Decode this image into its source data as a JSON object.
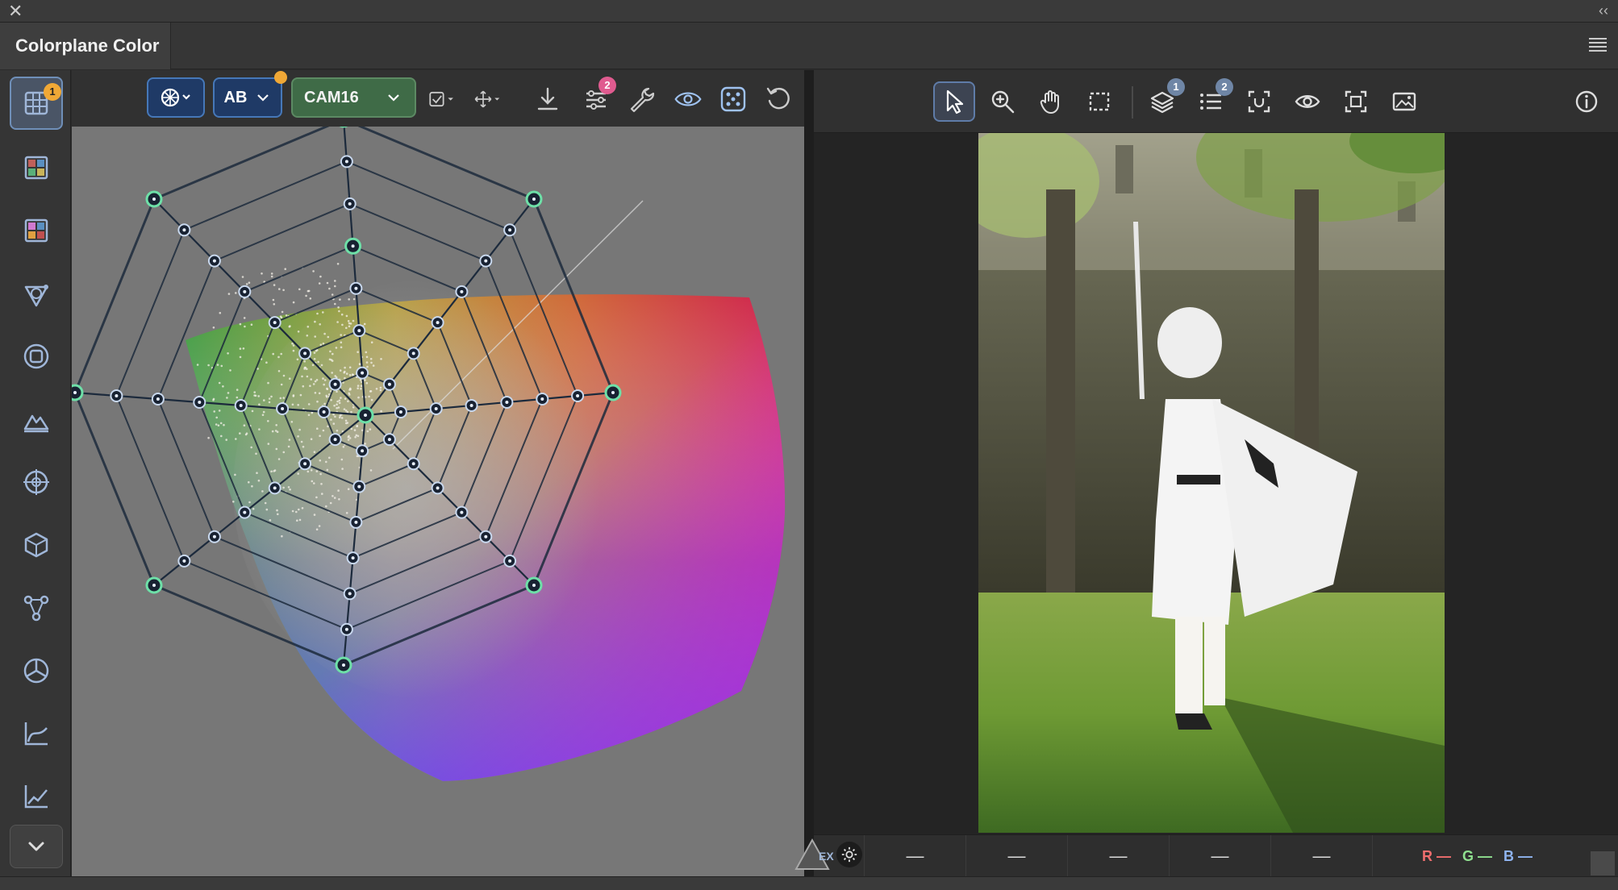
{
  "window": {
    "close_icon": "close-icon",
    "collapse_label": "‹‹"
  },
  "tab": {
    "title": "Colorplane Color"
  },
  "rail": {
    "badge": "1",
    "items": [
      "grid-icon",
      "swatch-grid-icon",
      "swatch-grid-color-icon",
      "gamut-triangle-icon",
      "square-circle-icon",
      "mountain-icon",
      "crosshair-icon",
      "cube-icon",
      "nodes-icon",
      "wheel-icon",
      "curve-icon",
      "chart-icon"
    ]
  },
  "plot_toolbar": {
    "mode_label": "AB",
    "model_label": "CAM16",
    "filters_badge": "2",
    "colors": {
      "accent_blue": "#4678b8",
      "badge_orange": "#f0a836",
      "badge_pink": "#e05b8f"
    }
  },
  "viewer_toolbar": {
    "layers_badge": "1",
    "list_badge": "2"
  },
  "status": {
    "ex_label": "EX",
    "cells": [
      "—",
      "—",
      "—",
      "—",
      "—"
    ],
    "r": "R —",
    "g": "G —",
    "b": "B —",
    "colors": {
      "r": "#f06e6e",
      "g": "#8fe08f",
      "b": "#8fb4f0"
    }
  }
}
